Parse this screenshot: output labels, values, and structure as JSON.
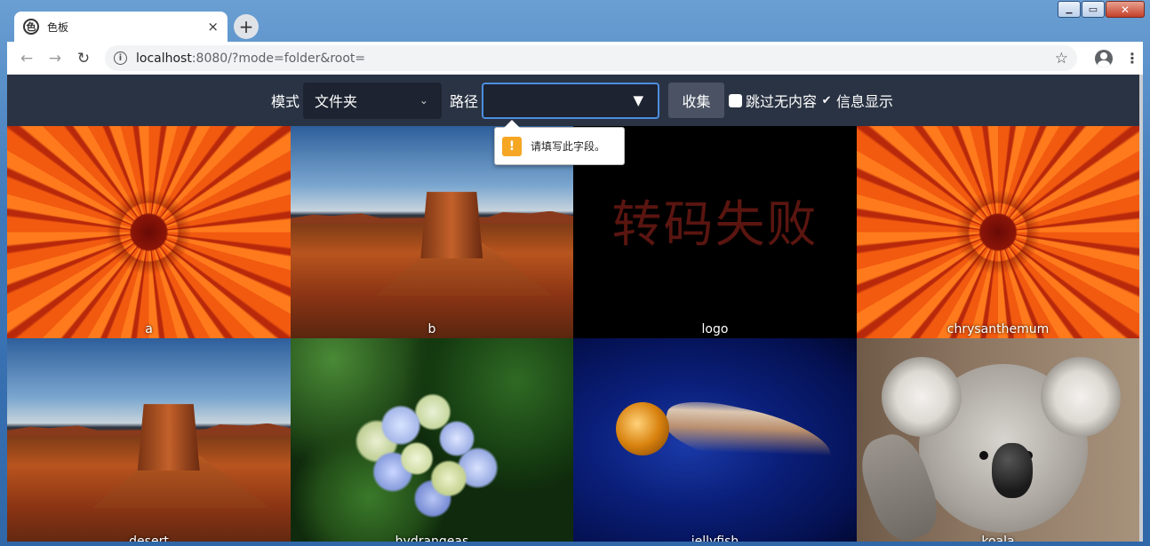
{
  "browser": {
    "tab_title": "色板",
    "tab_close": "×",
    "new_tab": "+",
    "url_host": "localhost",
    "url_rest": ":8080/?mode=folder&root=",
    "window_controls": {
      "minimize": "▁",
      "maximize": "▭",
      "close": "✕"
    }
  },
  "controls": {
    "mode_label": "模式",
    "mode_value": "文件夹",
    "path_label": "路径",
    "path_value": "",
    "collect_button": "收集",
    "skip_empty_label": "跳过无内容",
    "skip_empty_checked": false,
    "info_display_label": "信息显示",
    "info_display_checked": true
  },
  "validation_tooltip": {
    "icon": "warning-icon",
    "icon_glyph": "!",
    "text": "请填写此字段。"
  },
  "tiles": [
    {
      "label": "a",
      "image": "chrysanthemum"
    },
    {
      "label": "b",
      "image": "desert"
    },
    {
      "label": "logo",
      "image": "failed",
      "fail_text": "转码失败"
    },
    {
      "label": "chrysanthemum",
      "image": "chrysanthemum"
    },
    {
      "label": "desert",
      "image": "desert"
    },
    {
      "label": "hydrangeas",
      "image": "hydrangeas"
    },
    {
      "label": "jellyfish",
      "image": "jellyfish"
    },
    {
      "label": "koala",
      "image": "koala"
    }
  ],
  "colors": {
    "page_background": "#2a3343",
    "input_background": "#1d2330",
    "focus_border": "#4c8ee0",
    "button_background": "#4a5263",
    "warning": "#f5a623",
    "fail_text": "#5a1510"
  }
}
